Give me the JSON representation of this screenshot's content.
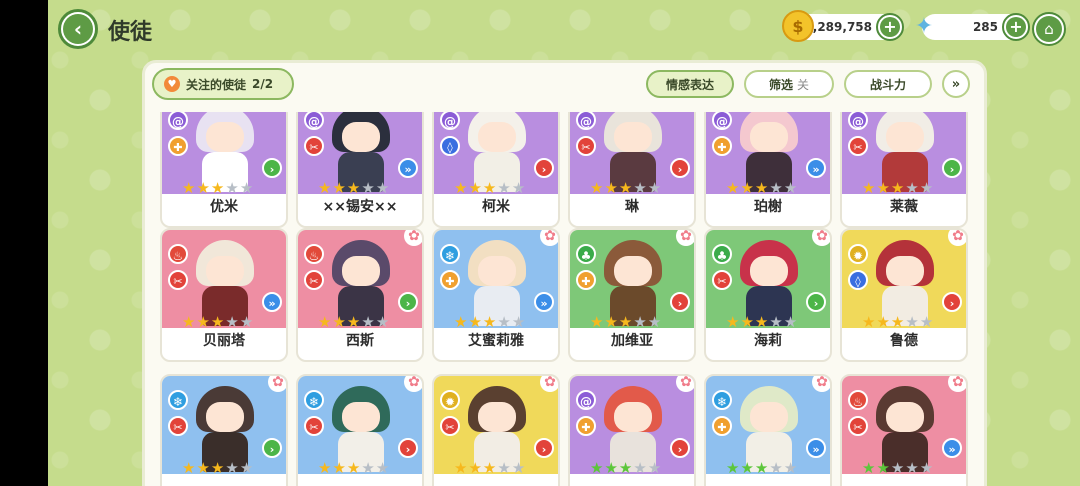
{
  "header": {
    "title": "使徒",
    "coins": "2,289,758",
    "gems": "285"
  },
  "toolbar": {
    "follow_label": "关注的使徒",
    "follow_count": "2/2",
    "emotion_label": "情感表达",
    "filter_label": "筛选",
    "filter_state": "关",
    "sort_label": "战斗力"
  },
  "icons": {
    "back": "back-arrow-icon",
    "coin": "coin-icon",
    "gem": "gem-icon",
    "home": "home-icon",
    "heart": "heart-icon",
    "collapse": "double-chevron-down-icon"
  },
  "colors": {
    "accent": "#5e9b45",
    "background": "#c5dc8c",
    "star_gold": "#f6b81d",
    "star_green": "#5cc63b"
  },
  "characters": [
    {
      "name": "优米",
      "bg": "purple",
      "element": "spiral",
      "role": "support",
      "arrow": "green",
      "stars": 3,
      "star_color": "gold",
      "flower": false,
      "hair": "#e8e2f2",
      "body": "#ffffff"
    },
    {
      "name": "××锡安××",
      "bg": "purple",
      "element": "spiral",
      "role": "dps",
      "arrow": "blue",
      "stars": 3,
      "star_color": "gold",
      "flower": false,
      "hair": "#2b2f3d",
      "body": "#3a3f52"
    },
    {
      "name": "柯米",
      "bg": "purple",
      "element": "spiral",
      "role": "tank",
      "arrow": "red",
      "stars": 3,
      "star_color": "gold",
      "flower": false,
      "hair": "#f4f1ea",
      "body": "#f2efe6"
    },
    {
      "name": "琳",
      "bg": "purple",
      "element": "spiral",
      "role": "dps",
      "arrow": "red",
      "stars": 3,
      "star_color": "gold",
      "flower": false,
      "hair": "#e9e4db",
      "body": "#5a3a40"
    },
    {
      "name": "珀榭",
      "bg": "purple",
      "element": "spiral",
      "role": "support",
      "arrow": "blue",
      "stars": 3,
      "star_color": "gold",
      "flower": false,
      "hair": "#f4c8cf",
      "body": "#3e2f3a"
    },
    {
      "name": "莱薇",
      "bg": "purple",
      "element": "spiral",
      "role": "dps",
      "arrow": "green",
      "stars": 3,
      "star_color": "gold",
      "flower": false,
      "hair": "#f1ede6",
      "body": "#b23a3a"
    },
    {
      "name": "贝丽塔",
      "bg": "pink",
      "element": "fire",
      "role": "dps",
      "arrow": "blue",
      "stars": 3,
      "star_color": "gold",
      "flower": false,
      "hair": "#f1e7d9",
      "body": "#7a2b2b"
    },
    {
      "name": "西斯",
      "bg": "pink",
      "element": "fire",
      "role": "dps",
      "arrow": "green",
      "stars": 3,
      "star_color": "gold",
      "flower": true,
      "hair": "#5a4a6a",
      "body": "#3b3446"
    },
    {
      "name": "艾蜜莉雅",
      "bg": "blue",
      "element": "ice",
      "role": "support",
      "arrow": "blue",
      "stars": 3,
      "star_color": "gold",
      "flower": true,
      "hair": "#f2dfc2",
      "body": "#e8ecf2"
    },
    {
      "name": "加维亚",
      "bg": "green",
      "element": "leaf",
      "role": "support",
      "arrow": "red",
      "stars": 3,
      "star_color": "gold",
      "flower": true,
      "hair": "#8b5a3a",
      "body": "#6b4a2b"
    },
    {
      "name": "海莉",
      "bg": "green",
      "element": "leaf",
      "role": "dps",
      "arrow": "green",
      "stars": 3,
      "star_color": "gold",
      "flower": true,
      "hair": "#c8324a",
      "body": "#2d3552"
    },
    {
      "name": "鲁德",
      "bg": "yellow",
      "element": "light",
      "role": "tank",
      "arrow": "red",
      "stars": 3,
      "star_color": "gold",
      "flower": true,
      "hair": "#b4323a",
      "body": "#f2ece2"
    },
    {
      "name": "",
      "bg": "blue",
      "element": "ice",
      "role": "dps",
      "arrow": "green",
      "stars": 3,
      "star_color": "gold",
      "flower": true,
      "hair": "#4a3a36",
      "body": "#3a2e2a"
    },
    {
      "name": "",
      "bg": "blue",
      "element": "ice",
      "role": "dps",
      "arrow": "red",
      "stars": 3,
      "star_color": "gold",
      "flower": true,
      "hair": "#2f6a5a",
      "body": "#f2efe8"
    },
    {
      "name": "",
      "bg": "yellow",
      "element": "light",
      "role": "dps",
      "arrow": "red",
      "stars": 3,
      "star_color": "gold",
      "flower": true,
      "hair": "#5a4030",
      "body": "#f2ede4"
    },
    {
      "name": "",
      "bg": "purple",
      "element": "spiral",
      "role": "support",
      "arrow": "red",
      "stars": 3,
      "star_color": "green",
      "flower": true,
      "hair": "#e25a4a",
      "body": "#e8e2dc"
    },
    {
      "name": "",
      "bg": "blue",
      "element": "ice",
      "role": "support",
      "arrow": "blue",
      "stars": 3,
      "star_color": "green",
      "flower": true,
      "hair": "#dfe9c8",
      "body": "#f2efe6"
    },
    {
      "name": "",
      "bg": "pink",
      "element": "fire",
      "role": "dps",
      "arrow": "blue",
      "stars": 2,
      "star_color": "green",
      "flower": true,
      "hair": "#5a3a32",
      "body": "#4a2e2a"
    }
  ]
}
